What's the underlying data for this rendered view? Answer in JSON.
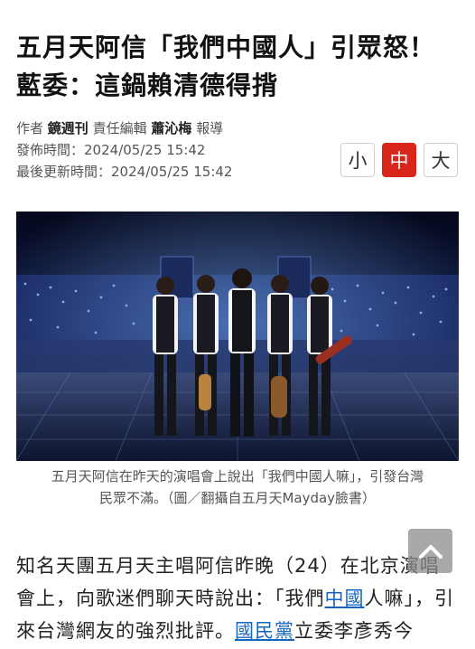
{
  "article": {
    "headline_line1": "五月天阿信「我們中國人」引眾怒！",
    "headline_line2": "藍委：這鍋賴清德得揹"
  },
  "meta": {
    "author_label": "作者",
    "author_name": "鏡週刊",
    "editor_label": "責任編輯",
    "editor_name": "蕭沁梅",
    "report_label": "報導",
    "published_label": "發佈時間：",
    "published_value": "2024/05/25 15:42",
    "updated_label": "最後更新時間：",
    "updated_value": "2024/05/25 15:42"
  },
  "font_size": {
    "small": "小",
    "medium": "中",
    "large": "大",
    "active": "medium",
    "active_color": "#d9261c"
  },
  "photo": {
    "caption_line1": "五月天阿信在昨天的演唱會上說出「我們中國人嘛」，引發台灣",
    "caption_line2": "民眾不滿。（圖／翻攝自五月天Mayday臉書）"
  },
  "body": {
    "seg1": "知名天團五月天主唱阿信昨晚（24）在北京演唱會上，向歌迷們聊天時說出：「我們",
    "link1": "中國",
    "seg2": "人嘛」，引來台灣網友的強烈批評。",
    "link2": "國民黨",
    "seg3": "立委李彥秀今"
  },
  "scroll_top": {
    "icon": "chevron-up-icon"
  }
}
